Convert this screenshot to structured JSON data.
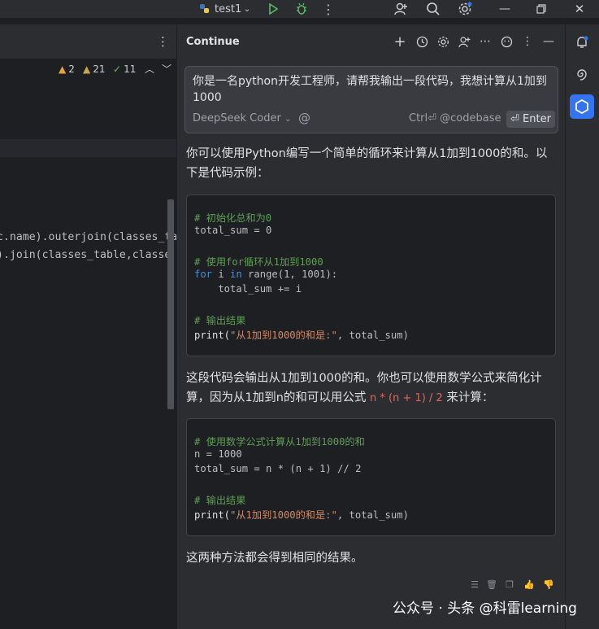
{
  "topbar": {
    "run_config": "test1",
    "icons": [
      "python-icon",
      "chevron-down-icon",
      "run-icon",
      "debug-icon",
      "more-icon",
      "add-user-icon",
      "search-icon",
      "settings-icon",
      "minimize-icon",
      "restore-icon",
      "close-icon"
    ]
  },
  "editor": {
    "more_icon": "⋮",
    "inspections": {
      "warnings": "2",
      "weak_warnings": "21",
      "ok": "11"
    },
    "lines": [
      "c.name).outerjoin(classes_ta",
      ").join(classes_table,classe"
    ]
  },
  "panel": {
    "title": "Continue",
    "input_text": "你是一名python开发工程师，请帮我输出一段代码，我想计算从1加到1000",
    "model": "DeepSeek Coder",
    "at_symbol": "@",
    "shortcut": "Ctrl⏎ @codebase",
    "enter_label": "⏎ Enter",
    "para1": "你可以使用Python编写一个简单的循环来计算从1加到1000的和。以下是代码示例：",
    "code1": {
      "c1": "# 初始化总和为0",
      "l1": "total_sum = 0",
      "c2": "# 使用for循环从1加到1000",
      "l2_kw1": "for",
      "l2_a": " i ",
      "l2_kw2": "in",
      "l2_b": " range(1, 1001):",
      "l3": "    total_sum += i",
      "c3": "# 输出结果",
      "l4_fn": "print(",
      "l4_str": "\"从1加到1000的和是:\"",
      "l4_rest": ", total_sum)"
    },
    "para2_a": "这段代码会输出从1加到1000的和。你也可以使用数学公式来简化计算，因为从1加到n的和可以用公式 ",
    "para2_formula": "n * (n + 1) / 2",
    "para2_b": " 来计算：",
    "code2": {
      "c1": "# 使用数学公式计算从1加到1000的和",
      "l1": "n = 1000",
      "l2": "total_sum = n * (n + 1) // 2",
      "c2": "# 输出结果",
      "l3_fn": "print(",
      "l3_str": "\"从1加到1000的和是:\"",
      "l3_rest": ", total_sum)"
    },
    "para3": "这两种方法都会得到相同的结果。"
  },
  "watermark": {
    "text": "公众号 · 头条 @科雷learning",
    "faint": "科雷learn"
  }
}
